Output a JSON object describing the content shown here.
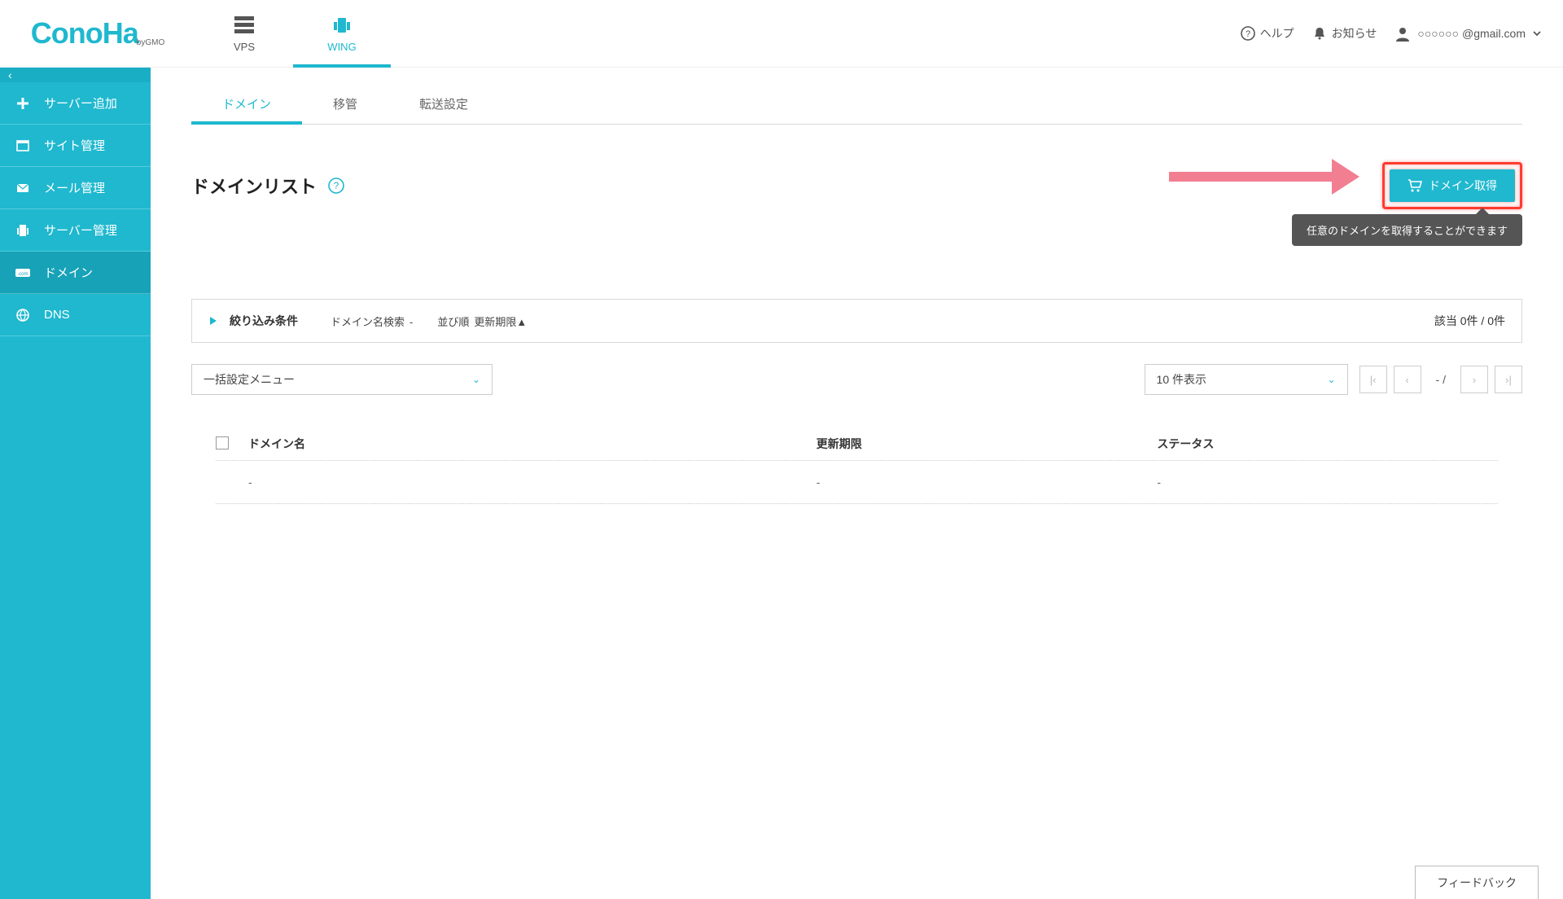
{
  "brand": {
    "name": "ConoHa",
    "sub": "byGMO"
  },
  "service_tabs": [
    {
      "id": "vps",
      "label": "VPS",
      "active": false
    },
    {
      "id": "wing",
      "label": "WING",
      "active": true
    }
  ],
  "header": {
    "help": "ヘルプ",
    "notice": "お知らせ",
    "user": "○○○○○○ @gmail.com"
  },
  "sidebar": {
    "items": [
      {
        "icon": "plus",
        "label": "サーバー追加"
      },
      {
        "icon": "window",
        "label": "サイト管理"
      },
      {
        "icon": "mail",
        "label": "メール管理"
      },
      {
        "icon": "server",
        "label": "サーバー管理"
      },
      {
        "icon": "domain",
        "label": "ドメイン",
        "active": true
      },
      {
        "icon": "globe",
        "label": "DNS"
      }
    ]
  },
  "sub_tabs": [
    {
      "label": "ドメイン",
      "active": true
    },
    {
      "label": "移管",
      "active": false
    },
    {
      "label": "転送設定",
      "active": false
    }
  ],
  "page": {
    "title": "ドメインリスト",
    "acquire_button": "ドメイン取得",
    "tooltip": "任意のドメインを取得することができます"
  },
  "filter": {
    "label": "絞り込み条件",
    "search_key": "ドメイン名検索",
    "search_val": "-",
    "sort_key": "並び順",
    "sort_val": "更新期限▲",
    "count": "該当 0件 / 0件"
  },
  "controls": {
    "bulk_menu": "一括設定メニュー",
    "per_page": "10 件表示",
    "page_info": "-  /"
  },
  "table": {
    "headers": {
      "name": "ドメイン名",
      "expiry": "更新期限",
      "status": "ステータス"
    },
    "rows": [
      {
        "name": "-",
        "expiry": "-",
        "status": "-"
      }
    ]
  },
  "feedback": "フィードバック"
}
